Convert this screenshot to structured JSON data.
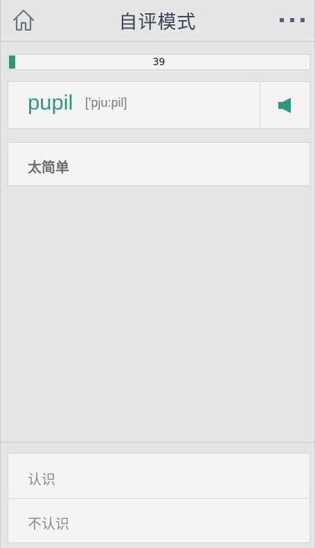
{
  "header": {
    "title": "自评模式",
    "home_icon": "home-icon",
    "more_icon": "more-dots-icon"
  },
  "progress": {
    "value_text": "39",
    "fill_fraction": 0.02,
    "accent": "#2a9978"
  },
  "word_card": {
    "word": "pupil",
    "phonetic": "['pju:pil]",
    "speaker_icon": "speaker-icon",
    "accent": "#2a9a80"
  },
  "options": {
    "too_easy": "太简单",
    "know": "认识",
    "dont_know": "不认识"
  }
}
